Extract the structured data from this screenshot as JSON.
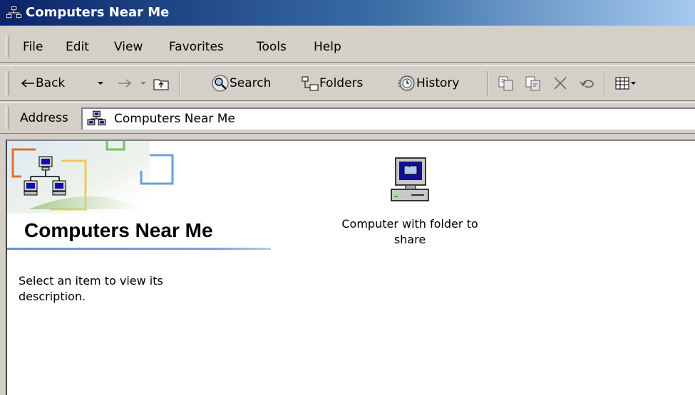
{
  "window": {
    "title": "Computers Near Me"
  },
  "menu": [
    "File",
    "Edit",
    "View",
    "Favorites",
    "Tools",
    "Help"
  ],
  "toolbar": {
    "back": "Back",
    "search": "Search",
    "folders": "Folders",
    "history": "History"
  },
  "address": {
    "label": "Address",
    "value": "Computers Near Me"
  },
  "info_panel": {
    "title": "Computers Near Me",
    "description": "Select an item to view its description."
  },
  "items": [
    {
      "label": "Computer with folder to share",
      "icon": "computer-icon"
    }
  ],
  "colors": {
    "titlebar": "#0a246a",
    "chrome": "#d4d0c8",
    "accent_rule": "#6a8fc8"
  }
}
